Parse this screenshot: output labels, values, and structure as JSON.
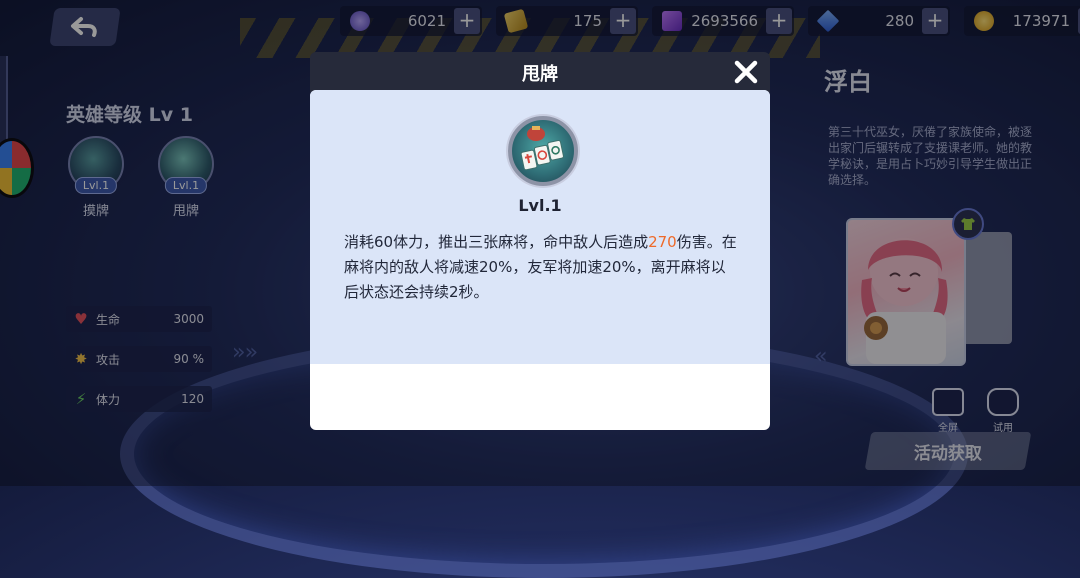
{
  "top": {
    "currencies": [
      {
        "icon": "energy-coin-icon",
        "value": "6021",
        "plus": "+"
      },
      {
        "icon": "ticket-icon",
        "value": "175",
        "plus": "+"
      },
      {
        "icon": "purple-gem-icon",
        "value": "2693566",
        "plus": "+"
      },
      {
        "icon": "blue-crystal-icon",
        "value": "280",
        "plus": "+"
      },
      {
        "icon": "gold-coin-icon",
        "value": "173971",
        "plus": "+"
      }
    ]
  },
  "hero": {
    "level_label": "英雄等级 Lv 1",
    "skills": [
      {
        "lvl": "Lvl.1",
        "name": "摸牌"
      },
      {
        "lvl": "Lvl.1",
        "name": "甩牌"
      }
    ],
    "stats": [
      {
        "icon": "heart-icon",
        "label": "生命",
        "value": "3000"
      },
      {
        "icon": "attack-icon",
        "label": "攻击",
        "value": "90 %"
      },
      {
        "icon": "stamina-icon",
        "label": "体力",
        "value": "120"
      }
    ]
  },
  "character": {
    "name": "浮白",
    "description": "第三十代巫女，厌倦了家族使命，被逐出家门后辗转成了支援课老师。她的教学秘诀，是用占卜巧妙引导学生做出正确选择。",
    "buttons": {
      "fullscreen": "全屏",
      "trial": "试用",
      "obtain": "活动获取"
    }
  },
  "dialog": {
    "title": "甩牌",
    "level": "Lvl.1",
    "desc_part1": "消耗60体力，推出三张麻将，命中敌人后造成",
    "desc_highlight": "270",
    "desc_part2": "伤害。在麻将内的敌人将减速20%，友军将加速20%，离开麻将以后状态还会持续2秒。"
  },
  "colors": {
    "highlight": "#ee6a2a",
    "dialog_header": "#262a3a",
    "dialog_top": "#dbe5f8"
  }
}
